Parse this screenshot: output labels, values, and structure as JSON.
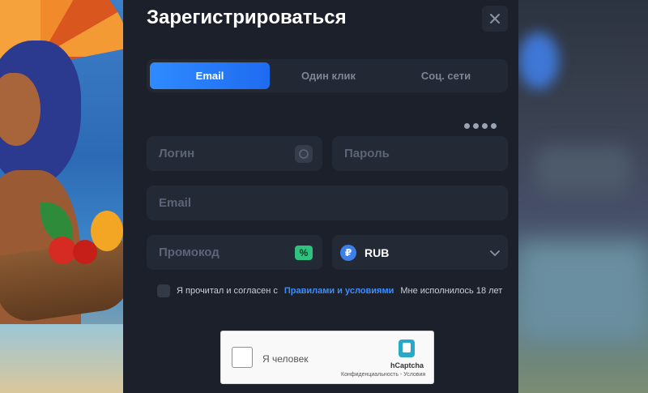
{
  "modal": {
    "title": "Зарегистрироваться",
    "close_icon": "close-icon"
  },
  "tabs": [
    {
      "label": "Email",
      "active": true
    },
    {
      "label": "Один клик",
      "active": false
    },
    {
      "label": "Соц. сети",
      "active": false
    }
  ],
  "form": {
    "login_placeholder": "Логин",
    "password_placeholder": "Пароль",
    "email_placeholder": "Email",
    "promo_placeholder": "Промокод",
    "currency": "RUB",
    "currency_icon": "ruble-icon",
    "refresh_icon": "refresh-icon",
    "promo_icon": "promo-ticket-icon",
    "chevron_icon": "chevron-down-icon"
  },
  "agreement": {
    "prefix": "Я прочитал и согласен с",
    "link": "Правилами и условиями",
    "suffix": "Мне исполнилось 18 лет"
  },
  "captcha": {
    "label": "Я человек",
    "brand": "hCaptcha",
    "terms": "Конфиденциальность - Условия"
  },
  "colors": {
    "accent": "#2f8bff",
    "modal_bg": "#1b202a",
    "field_bg": "#232935",
    "promo_green": "#2ec27e"
  }
}
